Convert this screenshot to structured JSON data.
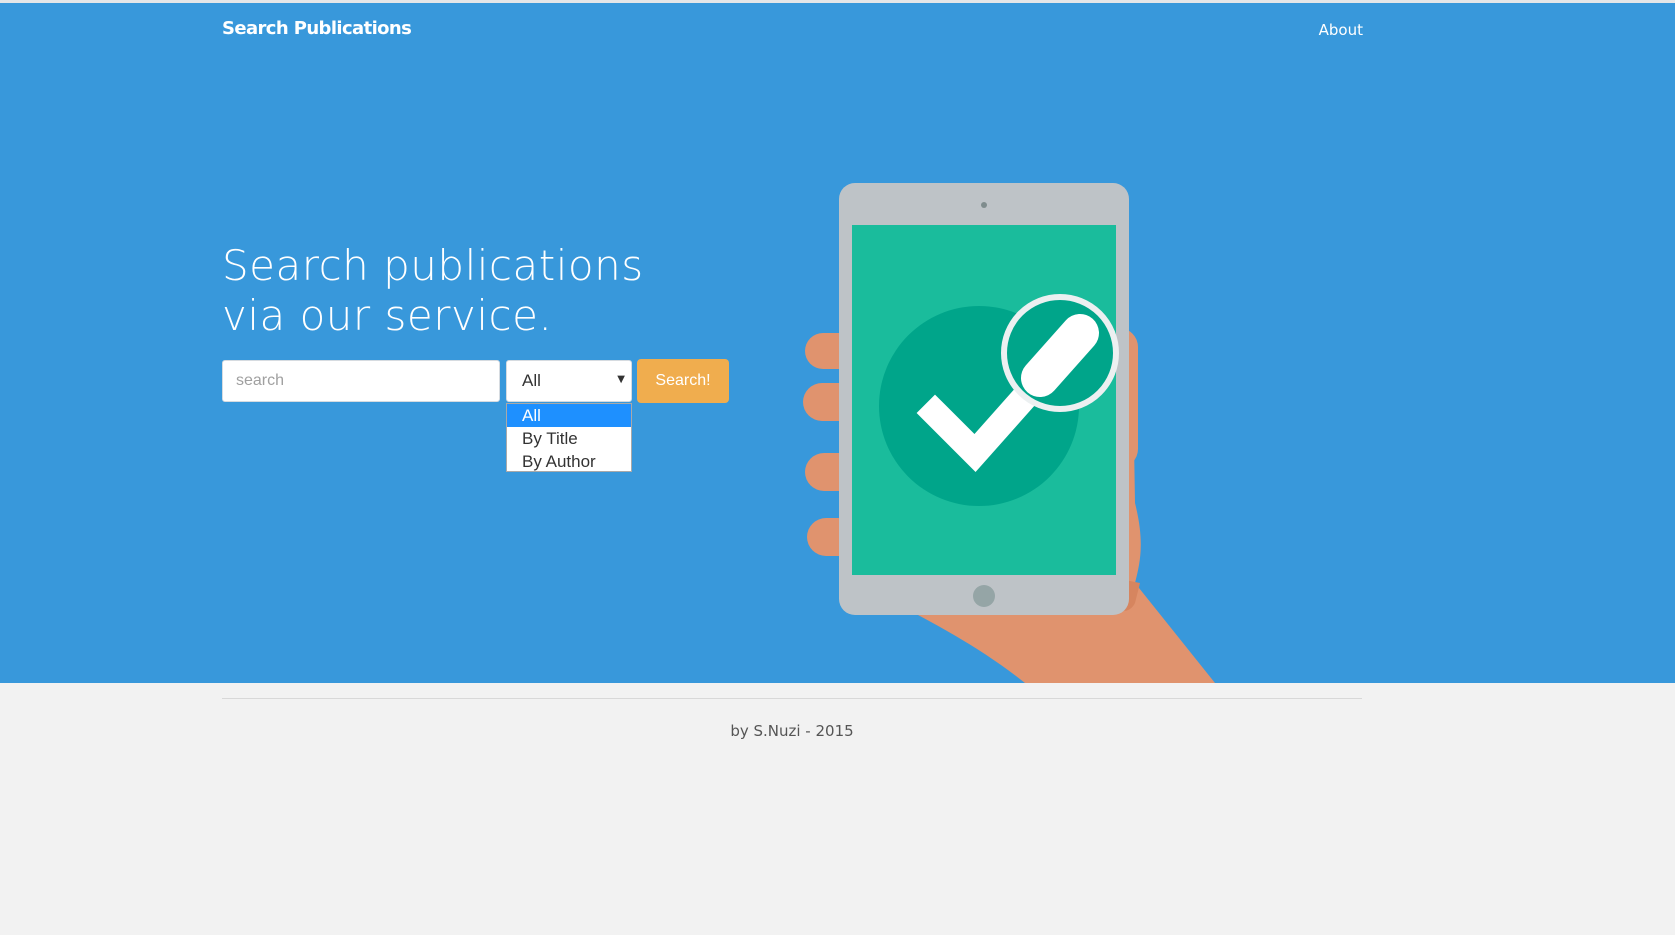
{
  "navbar": {
    "brand": "Search Publications",
    "about_link": "About"
  },
  "hero": {
    "headline_line1": "Search publications",
    "headline_line2": "via our service."
  },
  "search": {
    "placeholder": "search",
    "value": "",
    "select_value": "All",
    "options": [
      "All",
      "By Title",
      "By Author"
    ],
    "selected_option": "All",
    "button_label": "Search!"
  },
  "footer": {
    "credit": "by S.Nuzi - 2015"
  },
  "colors": {
    "hero_bg": "#3898db",
    "button": "#f0ad4e",
    "screen": "#1abc9c",
    "circle": "#00a58a",
    "hand": "#e0936e"
  },
  "illustration": {
    "icons": [
      "tablet-icon",
      "hand-icon",
      "checkmark-icon",
      "magnifier-icon"
    ]
  }
}
